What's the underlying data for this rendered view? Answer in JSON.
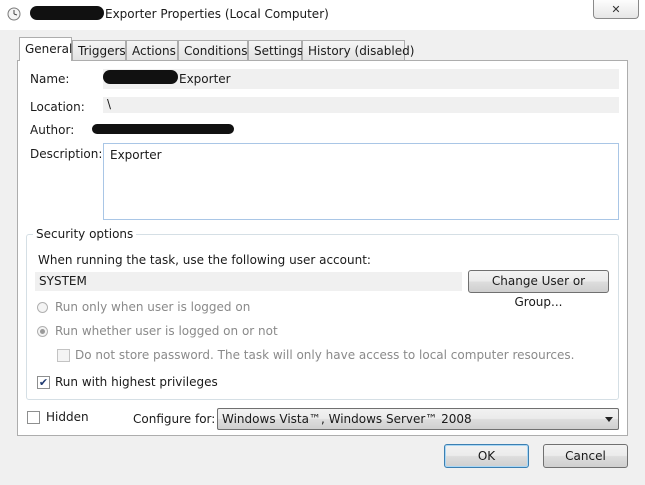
{
  "window": {
    "title": "Exporter Properties (Local Computer)",
    "close_label": "✕"
  },
  "tabs": [
    {
      "label": "General",
      "active": true
    },
    {
      "label": "Triggers"
    },
    {
      "label": "Actions"
    },
    {
      "label": "Conditions"
    },
    {
      "label": "Settings"
    },
    {
      "label": "History (disabled)"
    }
  ],
  "general": {
    "name_label": "Name:",
    "name_value": "Exporter",
    "location_label": "Location:",
    "location_value": "\\",
    "author_label": "Author:",
    "description_label": "Description:",
    "description_value": "Exporter"
  },
  "security": {
    "title": "Security options",
    "account_prompt": "When running the task, use the following user account:",
    "account_value": "SYSTEM",
    "change_button": "Change User or Group...",
    "radio_logged_on": "Run only when user is logged on",
    "radio_whether": "Run whether user is logged on or not",
    "no_store_password": "Do not store password.  The task will only have access to local computer resources.",
    "highest_privileges": "Run with highest privileges",
    "highest_privileges_checked": true
  },
  "footer": {
    "hidden_label": "Hidden",
    "configure_label": "Configure for:",
    "configure_value": "Windows Vista™, Windows Server™ 2008",
    "ok_label": "OK",
    "cancel_label": "Cancel"
  }
}
